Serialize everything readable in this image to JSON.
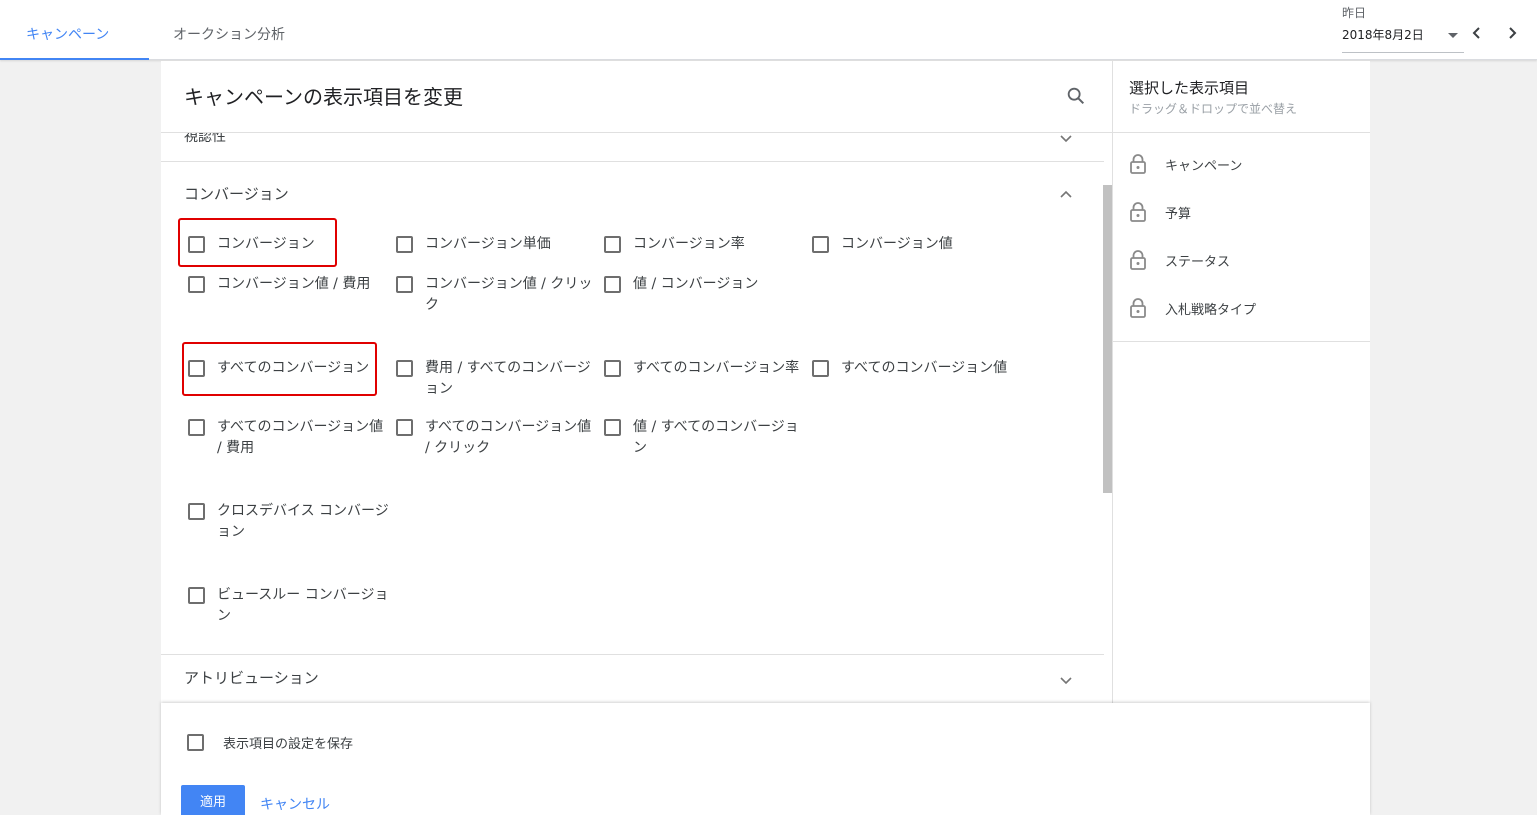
{
  "tabs": [
    {
      "label": "キャンペーン",
      "active": true
    },
    {
      "label": "オークション分析",
      "active": false
    }
  ],
  "date": {
    "label": "昨日",
    "value": "2018年8月2日"
  },
  "dialog": {
    "title": "キャンペーンの表示項目を変更",
    "sections": {
      "visibility": {
        "label": "視認性",
        "expanded": false
      },
      "conversions": {
        "label": "コンバージョン",
        "expanded": true
      },
      "attribution": {
        "label": "アトリビューション",
        "expanded": false
      }
    },
    "conversion_items": [
      "コンバージョン",
      "コンバージョン単価",
      "コンバージョン率",
      "コンバージョン値",
      "コンバージョン値 / 費用",
      "コンバージョン値 / クリック",
      "値 / コンバージョン",
      "すべてのコンバージョン",
      "費用 / すべてのコンバージョン",
      "すべてのコンバージョン率",
      "すべてのコンバージョン値",
      "すべてのコンバージョン値 / 費用",
      "すべてのコンバージョン値 / クリック",
      "値 / すべてのコンバージョン",
      "クロスデバイス コンバージョン",
      "ビュースルー コンバージョン"
    ],
    "highlighted_items": [
      "コンバージョン",
      "すべてのコンバージョン"
    ],
    "selected_panel": {
      "title": "選択した表示項目",
      "subtitle": "ドラッグ＆ドロップで並べ替え",
      "items": [
        "キャンペーン",
        "予算",
        "ステータス",
        "入札戦略タイプ"
      ]
    },
    "footer": {
      "save_label": "表示項目の設定を保存",
      "apply_label": "適用",
      "cancel_label": "キャンセル"
    }
  },
  "colors": {
    "accent": "#4285f4",
    "highlight": "#e00000"
  }
}
